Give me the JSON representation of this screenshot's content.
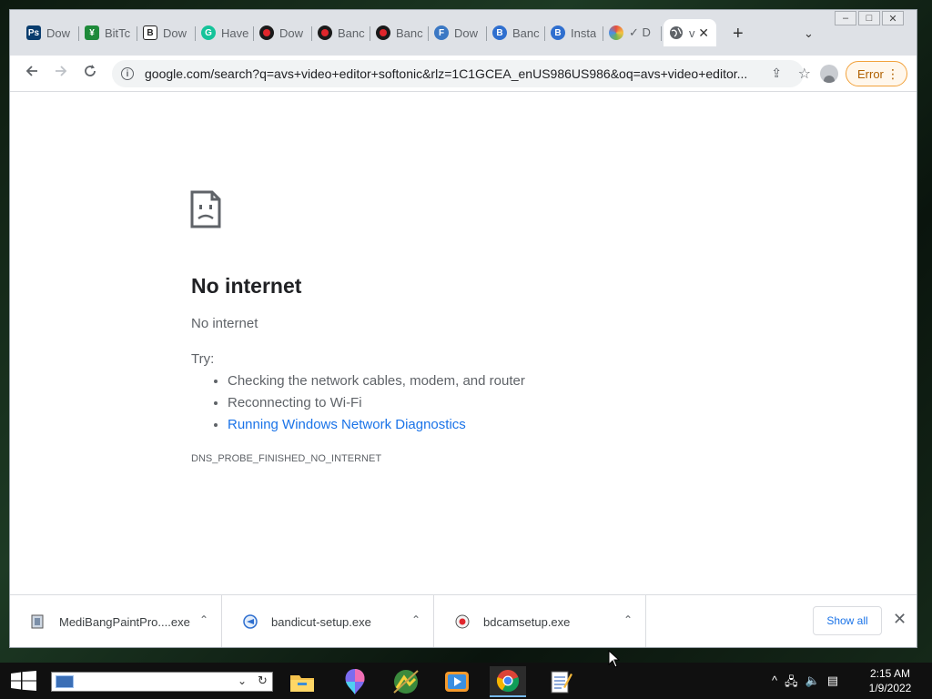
{
  "tabs": [
    {
      "label": "Dow",
      "icon": "photoshop-icon",
      "color": "#0a3d6e",
      "glyph": "Ps"
    },
    {
      "label": "BitTc",
      "icon": "bittorrent-icon",
      "color": "#1e8a3a",
      "glyph": "¥"
    },
    {
      "label": "Dow",
      "icon": "b-logo-icon",
      "color": "#222222",
      "glyph": "B"
    },
    {
      "label": "Have",
      "icon": "grammarly-icon",
      "color": "#15c39a",
      "glyph": "G"
    },
    {
      "label": "Dow",
      "icon": "bandicam-icon",
      "color": "#1a1a1a",
      "glyph": ""
    },
    {
      "label": "Banc",
      "icon": "bandicam-icon",
      "color": "#1a1a1a",
      "glyph": ""
    },
    {
      "label": "Banc",
      "icon": "bandicam-icon",
      "color": "#1a1a1a",
      "glyph": ""
    },
    {
      "label": "Dow",
      "icon": "fh-icon",
      "color": "#3b78c4",
      "glyph": "F"
    },
    {
      "label": "Banc",
      "icon": "b-blue-icon",
      "color": "#2f6fcf",
      "glyph": "B"
    },
    {
      "label": "Insta",
      "icon": "b-blue-icon",
      "color": "#2f6fcf",
      "glyph": "B"
    },
    {
      "label": "✓ D",
      "icon": "colorful-icon",
      "color": "#6fb44f",
      "glyph": ""
    }
  ],
  "active_tab": {
    "label": "v",
    "icon": "globe-icon"
  },
  "window_controls": {
    "minimize": "–",
    "maximize": "□",
    "close": "✕"
  },
  "toolbar": {
    "url": "google.com/search?q=avs+video+editor+softonic&rlz=1C1GCEA_enUS986US986&oq=avs+video+editor...",
    "error_label": "Error"
  },
  "page": {
    "title": "No internet",
    "subtitle": "No internet",
    "try_label": "Try:",
    "suggestions": [
      "Checking the network cables, modem, and router",
      "Reconnecting to Wi-Fi"
    ],
    "diagnostics_link": "Running Windows Network Diagnostics",
    "error_code": "DNS_PROBE_FINISHED_NO_INTERNET"
  },
  "downloads": {
    "items": [
      {
        "name": "MediBangPaintPro....exe",
        "icon": "installer-icon"
      },
      {
        "name": "bandicut-setup.exe",
        "icon": "bandicut-icon"
      },
      {
        "name": "bdcamsetup.exe",
        "icon": "bandicam-setup-icon"
      }
    ],
    "show_all": "Show all"
  },
  "taskbar": {
    "time": "2:15 AM",
    "date": "1/9/2022"
  }
}
